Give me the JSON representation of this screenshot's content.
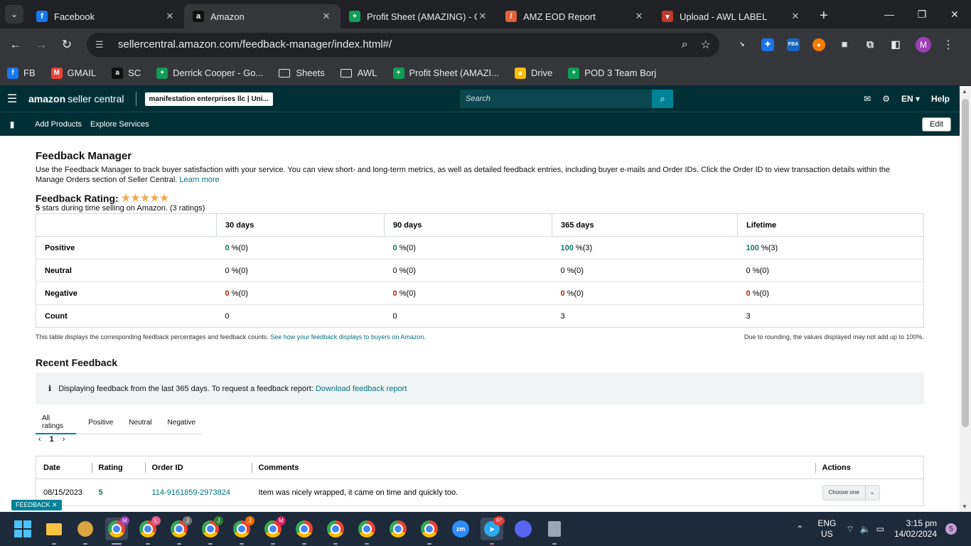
{
  "browser": {
    "tabs": [
      {
        "title": "Facebook",
        "icon": "facebook-icon",
        "color": "#1877f2",
        "glyph": "f"
      },
      {
        "title": "Amazon",
        "icon": "amazon-icon",
        "color": "#111111",
        "glyph": "a"
      },
      {
        "title": "Profit Sheet (AMAZING) - Go",
        "icon": "google-sheets-icon",
        "color": "#0f9d58",
        "glyph": "+"
      },
      {
        "title": "AMZ EOD Report",
        "icon": "zapier-icon",
        "color": "#e0623a",
        "glyph": "/"
      },
      {
        "title": "Upload - AWL LABEL",
        "icon": "awl-icon",
        "color": "#c0392b",
        "glyph": "▾"
      }
    ],
    "url": "sellercentral.amazon.com/feedback-manager/index.html#/",
    "bookmarks": [
      {
        "label": "FB",
        "icon": "facebook-icon",
        "color": "#1877f2",
        "glyph": "f"
      },
      {
        "label": "GMAIL",
        "icon": "gmail-icon",
        "color": "#ea4335",
        "glyph": "M"
      },
      {
        "label": "SC",
        "icon": "amazon-icon",
        "color": "#111111",
        "glyph": "a"
      },
      {
        "label": "Derrick Cooper - Go...",
        "icon": "google-sheets-icon",
        "color": "#0f9d58",
        "glyph": "+"
      },
      {
        "label": "Sheets",
        "icon": "folder-icon",
        "folder": true
      },
      {
        "label": "AWL",
        "icon": "folder-icon",
        "folder": true
      },
      {
        "label": "Profit Sheet (AMAZI...",
        "icon": "google-sheets-icon",
        "color": "#0f9d58",
        "glyph": "+"
      },
      {
        "label": "Drive",
        "icon": "google-drive-icon",
        "color": "#fbbc05",
        "glyph": "▲"
      },
      {
        "label": "POD 3 Team Borj",
        "icon": "google-sheets-icon",
        "color": "#0f9d58",
        "glyph": "+"
      }
    ],
    "profile_initial": "M"
  },
  "sc": {
    "logo_bold": "amazon",
    "logo_rest": "seller central",
    "account": "manifestation enterprises llc | Uni...",
    "search_placeholder": "Search",
    "lang": "EN",
    "help": "Help",
    "nav": [
      "Add Products",
      "Explore Services"
    ],
    "edit": "Edit"
  },
  "page": {
    "title": "Feedback Manager",
    "description": "Use the Feedback Manager to track buyer satisfaction with your service. You can view short- and long-term metrics, as well as detailed feedback entries, including buyer e-mails and Order IDs. Click the Order ID to view transaction details within the Manage Orders section of Seller Central.",
    "learn_more": "Learn more",
    "rating_heading": "Feedback Rating:",
    "stars": "★★★★★",
    "rating_stars_value": "5",
    "rating_sub": "stars during time selling on Amazon. (3 ratings)",
    "metrics": {
      "columns": [
        "30 days",
        "90 days",
        "365 days",
        "Lifetime"
      ],
      "rows": [
        {
          "label": "Positive",
          "kind": "pos",
          "cells": [
            {
              "n": "0",
              "p": "%(0)"
            },
            {
              "n": "0",
              "p": "%(0)"
            },
            {
              "n": "100",
              "p": "%(3)"
            },
            {
              "n": "100",
              "p": "%(3)"
            }
          ]
        },
        {
          "label": "Neutral",
          "kind": "neu",
          "cells": [
            {
              "n": "0",
              "p": "%(0)"
            },
            {
              "n": "0",
              "p": "%(0)"
            },
            {
              "n": "0",
              "p": "%(0)"
            },
            {
              "n": "0",
              "p": "%(0)"
            }
          ]
        },
        {
          "label": "Negative",
          "kind": "neg",
          "cells": [
            {
              "n": "0",
              "p": "%(0)"
            },
            {
              "n": "0",
              "p": "%(0)"
            },
            {
              "n": "0",
              "p": "%(0)"
            },
            {
              "n": "0",
              "p": "%(0)"
            }
          ]
        },
        {
          "label": "Count",
          "kind": "cnt",
          "cells": [
            {
              "n": "0",
              "p": ""
            },
            {
              "n": "0",
              "p": ""
            },
            {
              "n": "3",
              "p": ""
            },
            {
              "n": "3",
              "p": ""
            }
          ]
        }
      ]
    },
    "table_note": "This table displays the corresponding feedback percentages and feedback counts.",
    "table_note_link": "See how your feedback displays to buyers on Amazon.",
    "rounding_note": "Due to rounding, the values displayed may not add up to 100%.",
    "recent_heading": "Recent Feedback",
    "info_text": "Displaying feedback from the last 365 days. To request a feedback report:",
    "info_link": "Download feedback report",
    "filter_tabs": [
      "All ratings",
      "Positive",
      "Neutral",
      "Negative"
    ],
    "page_number": "1",
    "feedback_columns": [
      "Date",
      "Rating",
      "Order ID",
      "Comments",
      "Actions"
    ],
    "feedback_rows": [
      {
        "date": "08/15/2023",
        "rating": "5",
        "order_id": "114-9161859-2973824",
        "comment": "Item was nicely wrapped, it came on time and quickly too.",
        "action": "Choose one"
      }
    ],
    "feedback_badge": "FEEDBACK"
  },
  "taskbar": {
    "lang_top": "ENG",
    "lang_bottom": "US",
    "time": "3:15 pm",
    "date": "14/02/2024",
    "notifications": "5",
    "telegram_badge": "87"
  }
}
